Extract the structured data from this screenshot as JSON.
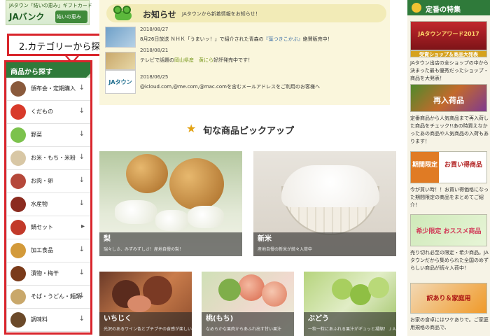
{
  "banner": {
    "line1": "JAタウン「結いの恵み」ギフトカード",
    "line2": "JAバンク",
    "badge": "結いの恵み"
  },
  "tooltip": {
    "text": "2.カテゴリーから探す"
  },
  "category": {
    "title": "商品から探す",
    "items": [
      {
        "label": "頒布会・定期購入",
        "icon_color": "#8a5a3c",
        "arrow": "↓"
      },
      {
        "label": "くだもの",
        "icon_color": "#d83a2a",
        "arrow": "↓"
      },
      {
        "label": "野菜",
        "icon_color": "#7cc24d",
        "arrow": "↓"
      },
      {
        "label": "お米・もち・米粉",
        "icon_color": "#d8c7a5",
        "arrow": "↓"
      },
      {
        "label": "お肉・卵",
        "icon_color": "#b5483a",
        "arrow": "↓"
      },
      {
        "label": "水産物",
        "icon_color": "#8b2b1f",
        "arrow": "↓"
      },
      {
        "label": "鍋セット",
        "icon_color": "#c23a2a",
        "arrow": "▸"
      },
      {
        "label": "加工食品",
        "icon_color": "#d39a3a",
        "arrow": "↓"
      },
      {
        "label": "漬物・梅干",
        "icon_color": "#7a3a1a",
        "arrow": "↓"
      },
      {
        "label": "そば・うどん・麺類",
        "icon_color": "#c9a86b",
        "arrow": "↓"
      },
      {
        "label": "調味料",
        "icon_color": "#6b4a2a",
        "arrow": "↓"
      }
    ]
  },
  "notice": {
    "title": "お知らせ",
    "subtitle": "JAタウンから新着情報をお知らせ！",
    "news": [
      {
        "date": "2018/08/27",
        "text_before": "8月26日放送 ＮＨＫ「うまいッ！」で紹介された青森の",
        "highlight": "『葉つきこかぶ』",
        "text_after": "絶賛販売中！"
      },
      {
        "date": "2018/08/21",
        "text_before": "テレビで話題の",
        "highlight": "岡山県産　黄にら",
        "text_after": "好評発売中です！"
      },
      {
        "date": "2018/06/25",
        "text_before": "@icloud.com,@me.com,@mac.comを含むメールアドレスをご利用のお客様へ",
        "highlight": "",
        "text_after": ""
      }
    ],
    "thumb3_label": "JAタウン"
  },
  "picks": {
    "title": "旬な商品ピックアップ",
    "cards": [
      {
        "name": "梨",
        "desc": "瑞々しさ、みずみずしさ！産地自慢の梨！"
      },
      {
        "name": "新米",
        "desc": "産地自慢の新米が続々入荷中"
      },
      {
        "name": "いちじく",
        "desc": "光沢のあるワイン色とプチプチの食感が楽しい"
      },
      {
        "name": "桃(もち)",
        "desc": "なめらかな果肉からあふれ出す甘い果汁"
      },
      {
        "name": "ぶどう",
        "desc": "一粒一粒にあふれる果汁がギュッと凝縮！ＪＡタウンで人気の品種を"
      }
    ]
  },
  "right": {
    "title": "定番の特集",
    "award_text": "JAタウンアワード2017",
    "award_bar": "受賞ショップ＆商品大発表",
    "award_desc": "JAタウン出店の全ショップの中から決まった最も優秀だったショップ・商品を大発表！",
    "saihan_text": "再入荷品",
    "saihan_desc": "定番商品から人気商品まで再入荷した商品をチェック!!あの時買えなかったあの商品や人気商品の入荷もあります！",
    "kikan_left": "期間限定",
    "kikan_right": "お買い得商品",
    "kikan_desc": "今が買い時！！お買い得価格になった期間限定の商品をまとめてご紹介！",
    "osusume_text": "希少限定 おススメ商品",
    "osusume_desc": "売り切れ必至の限定・希少商品。JAタウンだから集められた全国のめずらしい商品が続々入荷中！",
    "wakeari_text": "訳あり＆家庭用",
    "wakeari_desc": "お家の食卓にはワケありで。ご家庭用規格の商品で、"
  }
}
